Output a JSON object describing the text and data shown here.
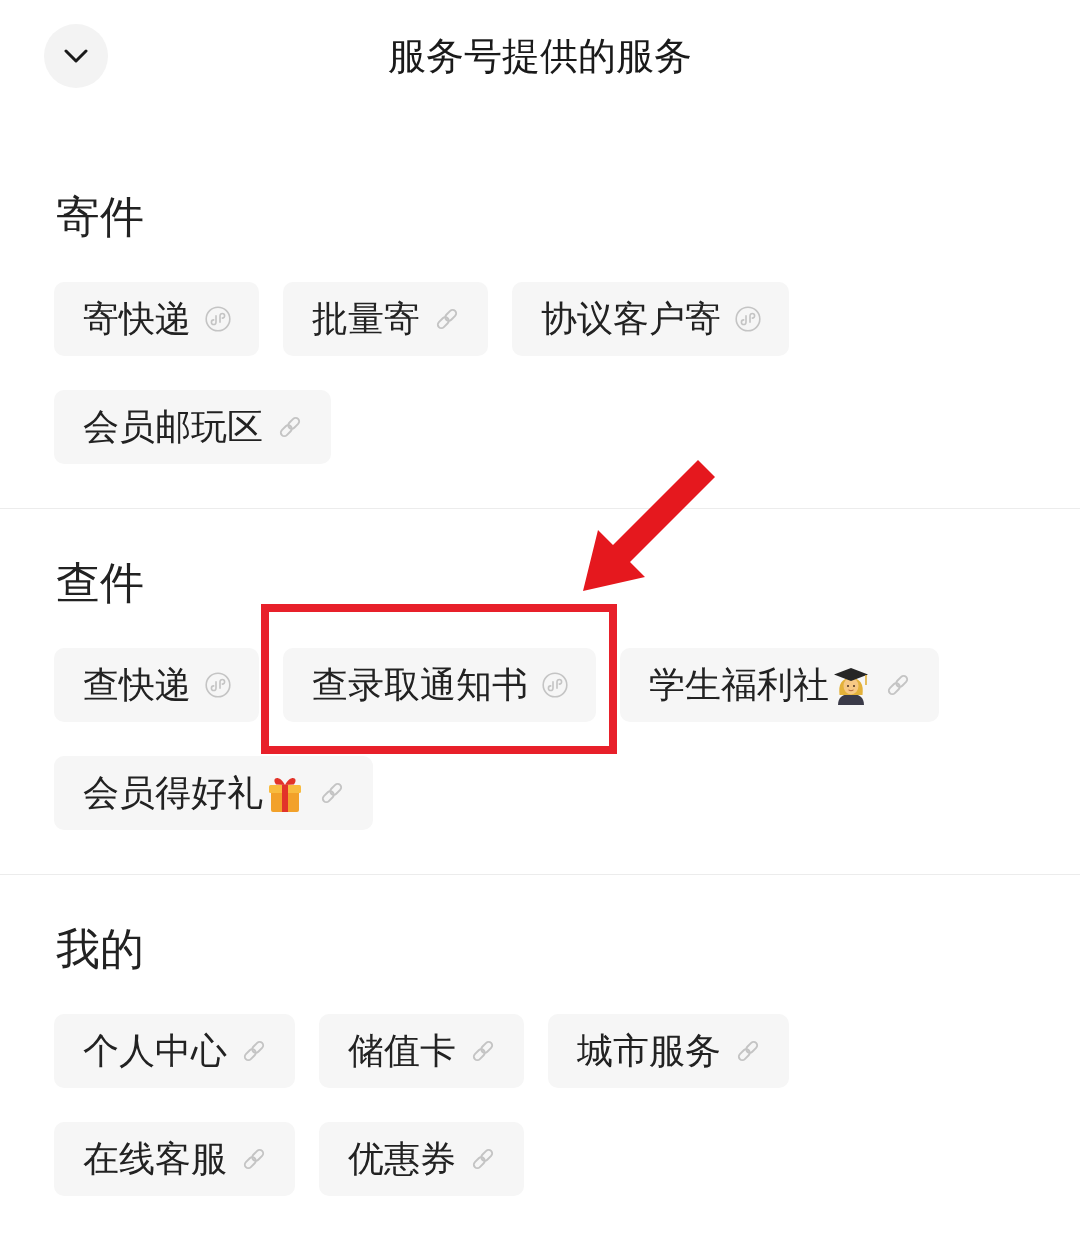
{
  "header": {
    "title": "服务号提供的服务"
  },
  "sections": [
    {
      "title": "寄件",
      "items": [
        {
          "label": "寄快递",
          "icons": [
            {
              "kind": "mini_program"
            }
          ],
          "highlighted": false
        },
        {
          "label": "批量寄",
          "icons": [
            {
              "kind": "link"
            }
          ],
          "highlighted": false
        },
        {
          "label": "协议客户寄",
          "icons": [
            {
              "kind": "mini_program"
            }
          ],
          "highlighted": false
        },
        {
          "label": "会员邮玩区",
          "icons": [
            {
              "kind": "link"
            }
          ],
          "highlighted": false
        }
      ]
    },
    {
      "title": "查件",
      "items": [
        {
          "label": "查快递",
          "icons": [
            {
              "kind": "mini_program"
            }
          ],
          "highlighted": false
        },
        {
          "label": "查录取通知书",
          "icons": [
            {
              "kind": "mini_program"
            }
          ],
          "highlighted": true
        },
        {
          "label": "学生福利社",
          "icons": [
            {
              "kind": "graduate"
            },
            {
              "kind": "link"
            }
          ],
          "highlighted": false
        },
        {
          "label": "会员得好礼",
          "icons": [
            {
              "kind": "gift"
            },
            {
              "kind": "link"
            }
          ],
          "highlighted": false
        }
      ]
    },
    {
      "title": "我的",
      "items": [
        {
          "label": "个人中心",
          "icons": [
            {
              "kind": "link"
            }
          ],
          "highlighted": false
        },
        {
          "label": "储值卡",
          "icons": [
            {
              "kind": "link"
            }
          ],
          "highlighted": false
        },
        {
          "label": "城市服务",
          "icons": [
            {
              "kind": "link"
            }
          ],
          "highlighted": false
        },
        {
          "label": "在线客服",
          "icons": [
            {
              "kind": "link"
            }
          ],
          "highlighted": false
        },
        {
          "label": "优惠券",
          "icons": [
            {
              "kind": "link"
            }
          ],
          "highlighted": false
        }
      ]
    }
  ]
}
